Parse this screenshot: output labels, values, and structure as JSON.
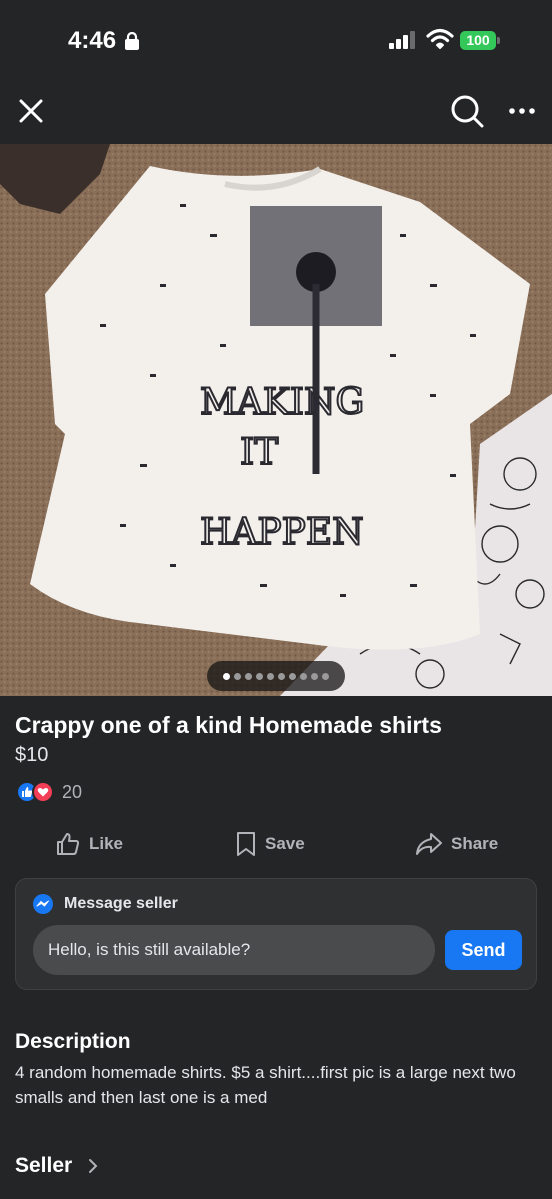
{
  "status_bar": {
    "time": "4:46",
    "battery": "100",
    "battery_color": "#34c759"
  },
  "nav": {
    "close_icon": "close-icon",
    "search_icon": "search-icon",
    "more_icon": "more-horizontal-icon"
  },
  "carousel": {
    "image_count": 10,
    "active_index": 0
  },
  "listing": {
    "title": "Crappy one of a kind Homemade shirts",
    "price": "$10",
    "reaction_count": "20"
  },
  "actions": {
    "like": "Like",
    "save": "Save",
    "share": "Share"
  },
  "message": {
    "header": "Message seller",
    "input_value": "Hello, is this still available?",
    "send": "Send",
    "accent": "#1877f2"
  },
  "description": {
    "heading": "Description",
    "text": "4 random homemade shirts. $5 a shirt....first pic is a large next two smalls and then last one is a med"
  },
  "seller": {
    "label": "Seller"
  }
}
